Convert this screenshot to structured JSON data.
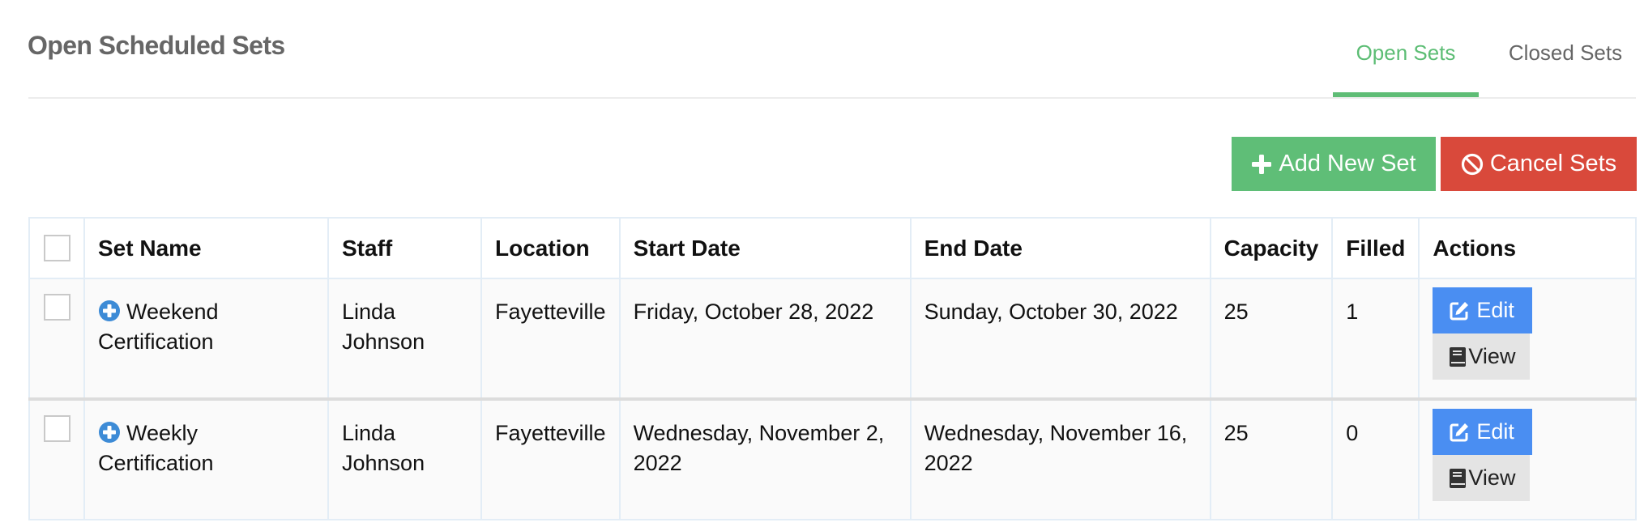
{
  "page": {
    "title": "Open Scheduled Sets"
  },
  "tabs": [
    {
      "label": "Open Sets",
      "active": true
    },
    {
      "label": "Closed Sets",
      "active": false
    }
  ],
  "toolbar": {
    "add_label": "Add New Set",
    "add_icon": "plus-icon",
    "cancel_label": "Cancel Sets",
    "cancel_icon": "ban-icon"
  },
  "colors": {
    "accent_green": "#5fbe77",
    "danger_red": "#d9493b",
    "edit_blue": "#4a8ef2",
    "expand_blue": "#3d8bd6",
    "title_gray": "#666666"
  },
  "table": {
    "columns": [
      "",
      "Set Name",
      "Staff",
      "Location",
      "Start Date",
      "End Date",
      "Capacity",
      "Filled",
      "Actions"
    ],
    "rows": [
      {
        "set_name": "Weekend Certification",
        "staff": "Linda Johnson",
        "location": "Fayetteville",
        "start_date": "Friday, October 28, 2022",
        "end_date": "Sunday, October 30, 2022",
        "capacity": "25",
        "filled": "1",
        "edit_label": "Edit",
        "view_label": "View"
      },
      {
        "set_name": "Weekly Certification",
        "staff": "Linda Johnson",
        "location": "Fayetteville",
        "start_date": "Wednesday, November 2, 2022",
        "end_date": "Wednesday, November 16, 2022",
        "capacity": "25",
        "filled": "0",
        "edit_label": "Edit",
        "view_label": "View"
      }
    ]
  }
}
